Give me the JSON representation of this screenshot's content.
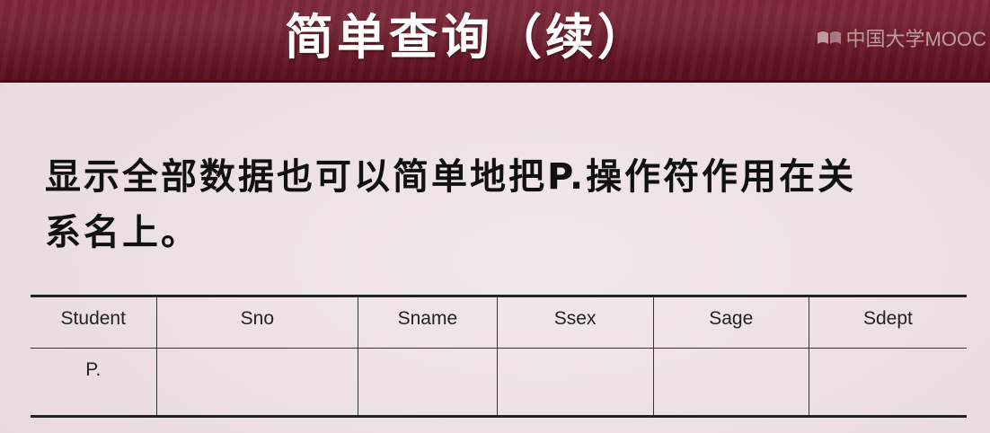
{
  "slide": {
    "title": "简单查询（续）",
    "watermark": "中国大学MOOC",
    "body_line_1": "显示全部数据也可以简单地把P.操作符作用在关",
    "body_line_2": "系名上。"
  },
  "table": {
    "headers": [
      "Student",
      "Sno",
      "Sname",
      "Ssex",
      "Sage",
      "Sdept"
    ],
    "rows": [
      [
        "P.",
        "",
        "",
        "",
        "",
        ""
      ]
    ]
  },
  "colors": {
    "banner": "#6a1626",
    "background": "#ecdfe3",
    "title_text": "#ffffff",
    "body_text": "#111111"
  }
}
